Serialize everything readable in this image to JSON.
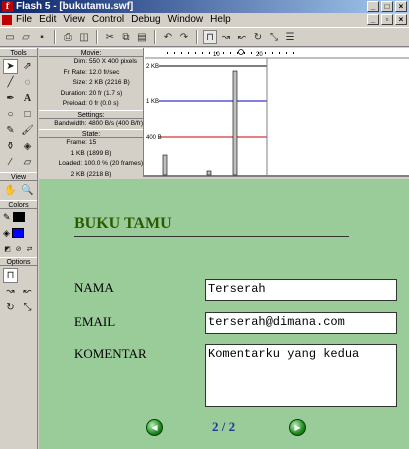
{
  "window": {
    "title": "Flash 5 - [bukutamu.swf]"
  },
  "menu": [
    "File",
    "Edit",
    "View",
    "Control",
    "Debug",
    "Window",
    "Help"
  ],
  "tools": {
    "section_tools": "Tools",
    "section_view": "View",
    "section_colors": "Colors",
    "section_options": "Options"
  },
  "profiler": {
    "movie_head": "Movie:",
    "movie": [
      {
        "k": "Dim:",
        "v": "550 X 400 pixels"
      },
      {
        "k": "Fr Rate:",
        "v": "12.0 fr/sec"
      },
      {
        "k": "Size:",
        "v": "2 KB (2216 B)"
      },
      {
        "k": "Duration:",
        "v": "20 fr (1.7 s)"
      },
      {
        "k": "Preload:",
        "v": "0 fr (0.0 s)"
      }
    ],
    "settings_head": "Settings:",
    "bandwidth": {
      "k": "Bandwidth:",
      "v": "4800 B/s (400 B/fr)"
    },
    "state_head": "State:",
    "frame": {
      "k": "Frame:",
      "v": "15"
    },
    "frame_size": "1 KB (1899 B)",
    "loaded": {
      "k": "Loaded:",
      "v": "100.0 % (20 frames)"
    },
    "loaded_size": "2 KB (2218 B)",
    "graph": {
      "ruler_10": "10",
      "ruler_20": "20",
      "label_2kb": "2 KB",
      "label_1kb": "1 KB",
      "label_400b": "400 B"
    }
  },
  "stage": {
    "heading": "BUKU TAMU",
    "nama_label": "NAMA",
    "nama_value": "Terserah",
    "email_label": "EMAIL",
    "email_value": "terserah@dimana.com",
    "komentar_label": "KOMENTAR",
    "komentar_value": "Komentarku yang kedua",
    "pager": "2 / 2"
  },
  "colors": {
    "stage_bg": "#99cc99",
    "heading": "#2d5a00",
    "pager": "#1a3a9a",
    "title_bar": "#0a246a",
    "limit_2kb": "#000000",
    "limit_1kb": "#0000cc",
    "limit_400b": "#cc0000"
  }
}
